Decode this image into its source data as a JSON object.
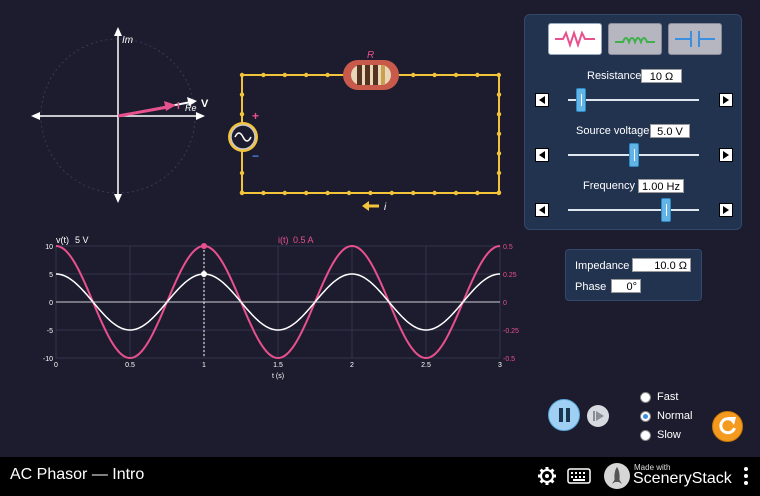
{
  "app": {
    "title": "AC Phasor — Intro",
    "brand_prefix": "Made with",
    "brand_name": "SceneryStack"
  },
  "phasor": {
    "im_label": "Im",
    "re_label": "Re",
    "v_label": "V",
    "i_label": "I"
  },
  "circuit": {
    "resistor_label": "R",
    "current_label": "i",
    "plus": "+",
    "minus": "−"
  },
  "controls": {
    "resistance": {
      "label": "Resistance",
      "value": "10 Ω",
      "level": 0.1
    },
    "voltage": {
      "label": "Source voltage",
      "value": "5.0 V",
      "level": 0.5
    },
    "frequency": {
      "label": "Frequency",
      "value": "1.00 Hz",
      "level": 0.75
    }
  },
  "info": {
    "impedance_label": "Impedance",
    "impedance_value": "10.0 Ω",
    "phase_label": "Phase",
    "phase_value": "0°"
  },
  "speed": {
    "options": [
      "Fast",
      "Normal",
      "Slow"
    ],
    "selected": "Normal"
  },
  "colors": {
    "voltage": "#ffffff",
    "current": "#e8508e",
    "panel": "#223350",
    "accent": "#62b4e6",
    "wire": "#f3c33a"
  },
  "chart_data": {
    "type": "line",
    "x": [
      0,
      0.25,
      0.5,
      0.75,
      1,
      1.25,
      1.5,
      1.75,
      2,
      2.25,
      2.5,
      2.75,
      3
    ],
    "series": [
      {
        "name": "v(t)",
        "unit_label": "5 V",
        "amplitude": 5,
        "values": [
          5,
          0,
          -5,
          0,
          5,
          0,
          -5,
          0,
          5,
          0,
          -5,
          0,
          5
        ]
      },
      {
        "name": "i(t)",
        "unit_label": "0.5 A",
        "amplitude": 0.5,
        "values": [
          0.5,
          0,
          -0.5,
          0,
          0.5,
          0,
          -0.5,
          0,
          0.5,
          0,
          -0.5,
          0,
          0.5
        ]
      }
    ],
    "xlabel": "t (s)",
    "xticks": [
      "0",
      "0.5",
      "1",
      "1.5",
      "2",
      "2.5",
      "3"
    ],
    "yticks_left": [
      "10",
      "5",
      "0",
      "-5",
      "-10"
    ],
    "yticks_right": [
      "0.5",
      "0.25",
      "0",
      "-0.25",
      "-0.5"
    ],
    "xlim": [
      0,
      3
    ],
    "ylim_left": [
      -10,
      10
    ],
    "ylim_right": [
      -0.5,
      0.5
    ],
    "cursor_t": 1,
    "grid": true
  }
}
